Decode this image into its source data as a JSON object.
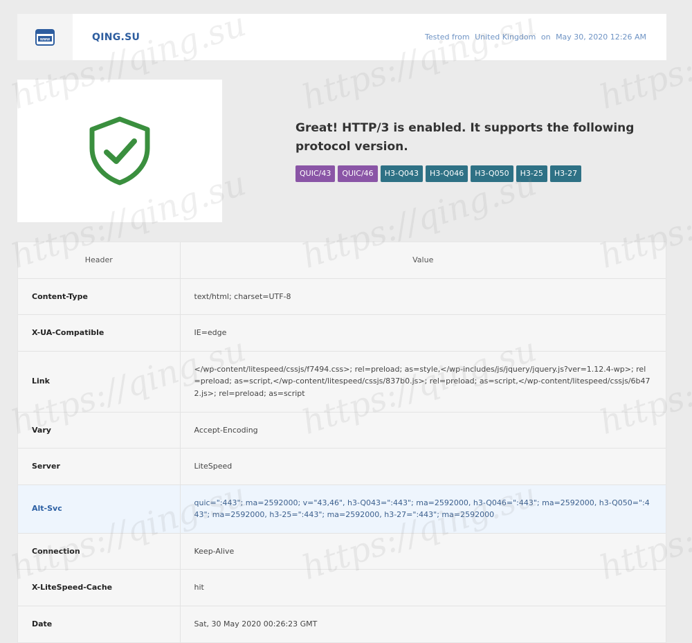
{
  "header": {
    "site_name": "QING.SU",
    "tested_prefix": "Tested from",
    "tested_location": "United Kingdom",
    "tested_on": "on",
    "tested_date": "May 30, 2020 12:26 AM",
    "logo_text": "www"
  },
  "result": {
    "message": "Great! HTTP/3 is enabled. It supports the following protocol version.",
    "status_icon": "shield-check-icon",
    "status_color": "#3a8f3e",
    "badges": [
      {
        "label": "QUIC/43",
        "color": "#8a55a6"
      },
      {
        "label": "QUIC/46",
        "color": "#8a55a6"
      },
      {
        "label": "H3-Q043",
        "color": "#2e7185"
      },
      {
        "label": "H3-Q046",
        "color": "#2e7185"
      },
      {
        "label": "H3-Q050",
        "color": "#2e7185"
      },
      {
        "label": "H3-25",
        "color": "#2e7185"
      },
      {
        "label": "H3-27",
        "color": "#2e7185"
      }
    ]
  },
  "table": {
    "headers": [
      "Header",
      "Value"
    ],
    "rows": [
      {
        "key": "Content-Type",
        "value": "text/html; charset=UTF-8"
      },
      {
        "key": "X-UA-Compatible",
        "value": "IE=edge"
      },
      {
        "key": "Link",
        "value": "</wp-content/litespeed/cssjs/f7494.css>; rel=preload; as=style,</wp-includes/js/jquery/jquery.js?ver=1.12.4-wp>; rel=preload; as=script,</wp-content/litespeed/cssjs/837b0.js>; rel=preload; as=script,</wp-content/litespeed/cssjs/6b472.js>; rel=preload; as=script"
      },
      {
        "key": "Vary",
        "value": "Accept-Encoding"
      },
      {
        "key": "Server",
        "value": "LiteSpeed"
      },
      {
        "key": "Alt-Svc",
        "value": "quic=\":443\"; ma=2592000; v=\"43,46\", h3-Q043=\":443\"; ma=2592000, h3-Q046=\":443\"; ma=2592000, h3-Q050=\":443\"; ma=2592000, h3-25=\":443\"; ma=2592000, h3-27=\":443\"; ma=2592000",
        "highlight": true
      },
      {
        "key": "Connection",
        "value": "Keep-Alive"
      },
      {
        "key": "X-LiteSpeed-Cache",
        "value": "hit"
      },
      {
        "key": "Date",
        "value": "Sat, 30 May 2020 00:26:23 GMT"
      }
    ]
  },
  "watermark": "https://qing.su"
}
